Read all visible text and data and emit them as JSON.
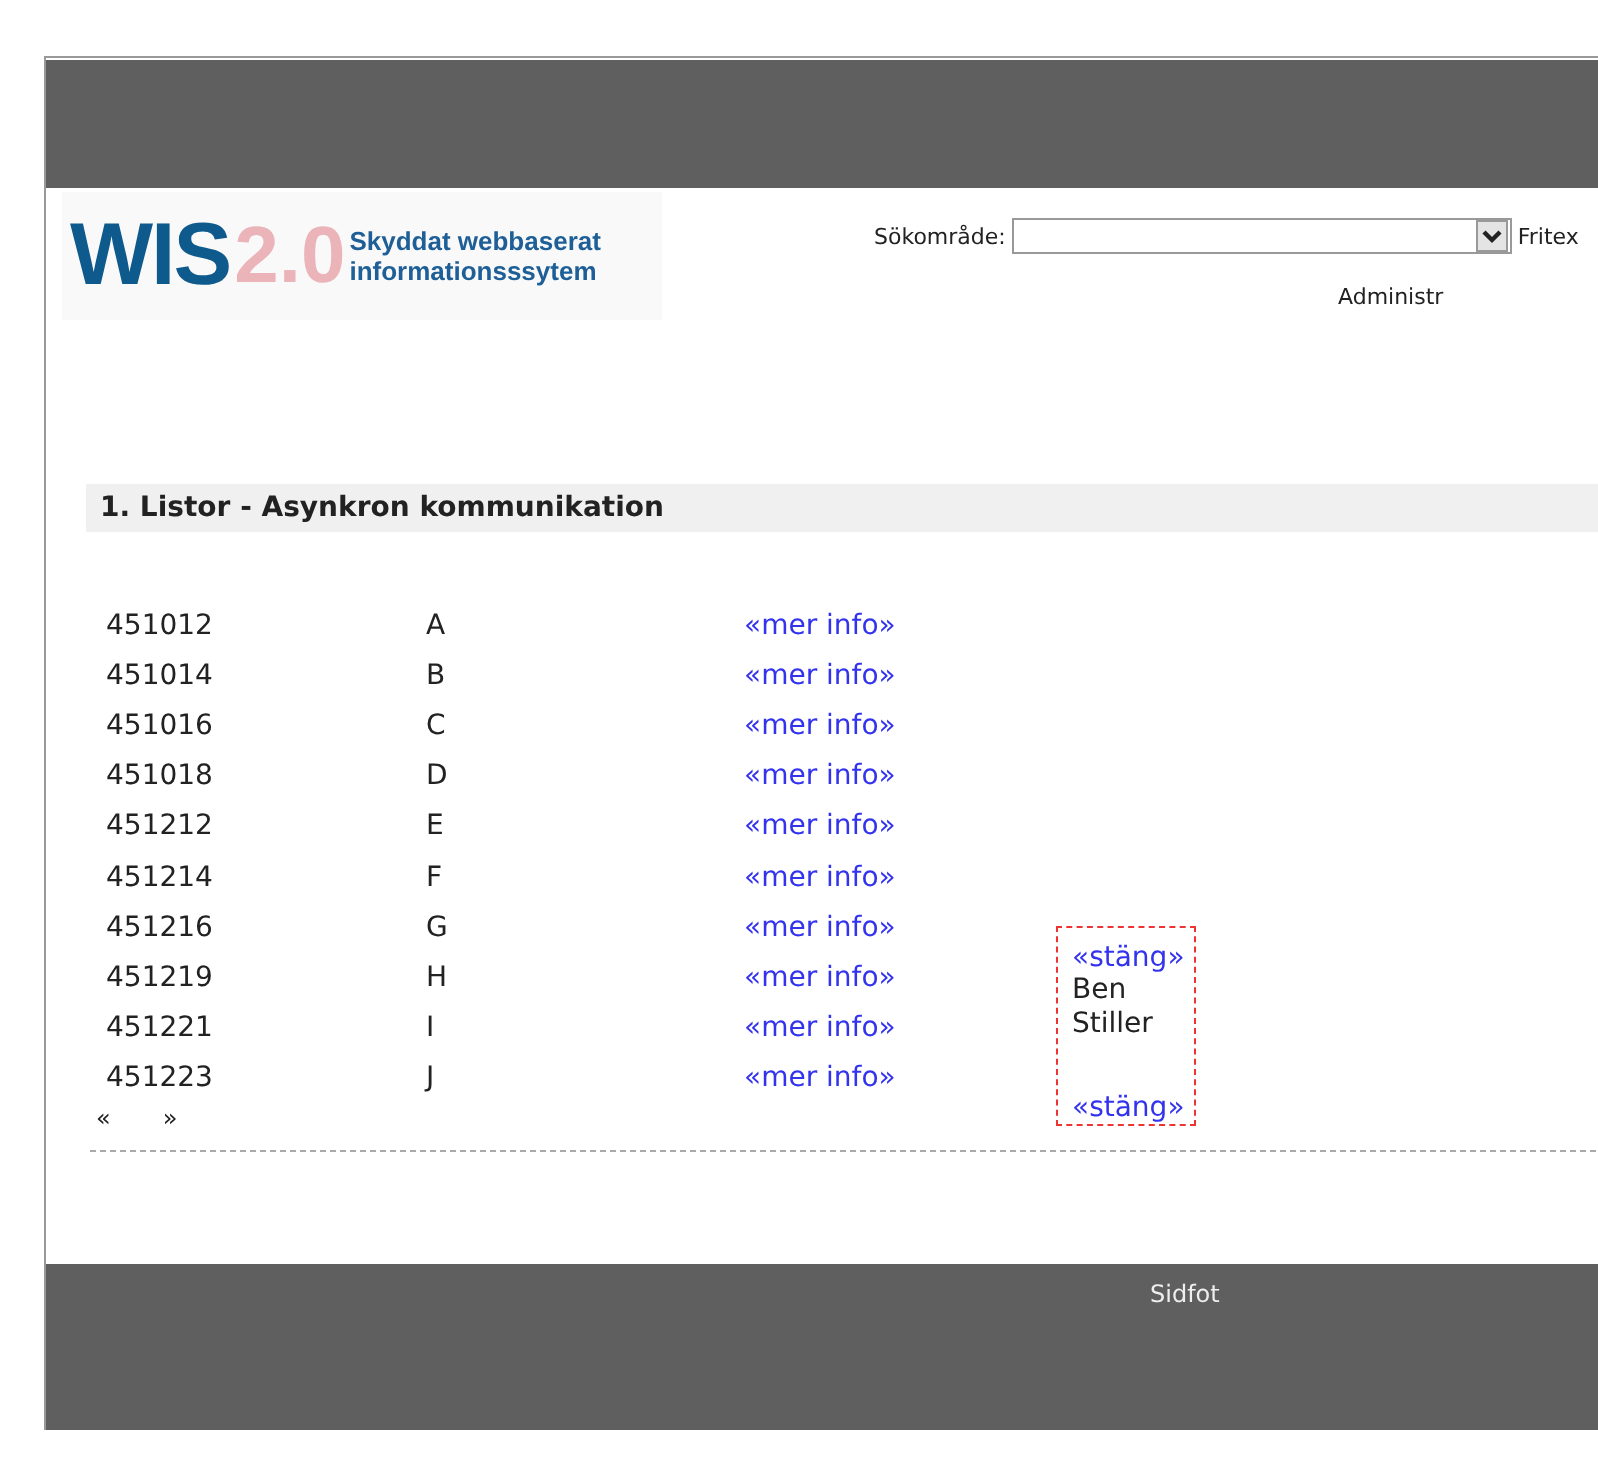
{
  "logo": {
    "mark": "WIS",
    "version": "2.0",
    "tagline_1": "Skyddat webbaserat",
    "tagline_2": "informationsssytem"
  },
  "search": {
    "label": "Sökområde:",
    "next_label": "Fritex"
  },
  "admin_link": "Administr",
  "section": {
    "title": "1. Listor - Asynkron kommunikation"
  },
  "rows": [
    {
      "id": "451012",
      "name": "A",
      "link": "«mer info»"
    },
    {
      "id": "451014",
      "name": "B",
      "link": "«mer info»"
    },
    {
      "id": "451016",
      "name": "C",
      "link": "«mer info»"
    },
    {
      "id": "451018",
      "name": "D",
      "link": "«mer info»"
    },
    {
      "id": "451212",
      "name": "E",
      "link": "«mer info»"
    },
    {
      "id": "451214",
      "name": "F",
      "link": "«mer info»"
    },
    {
      "id": "451216",
      "name": "G",
      "link": "«mer info»"
    },
    {
      "id": "451219",
      "name": "H",
      "link": "«mer info»"
    },
    {
      "id": "451221",
      "name": "I",
      "link": "«mer info»"
    },
    {
      "id": "451223",
      "name": "J",
      "link": "«mer info»"
    }
  ],
  "pager": {
    "prev": "«",
    "next": "»"
  },
  "popup": {
    "close_top": "«stäng»",
    "text": "Ben Stiller",
    "close_bottom": "«stäng»"
  },
  "footer": {
    "text": "Sidfot"
  }
}
